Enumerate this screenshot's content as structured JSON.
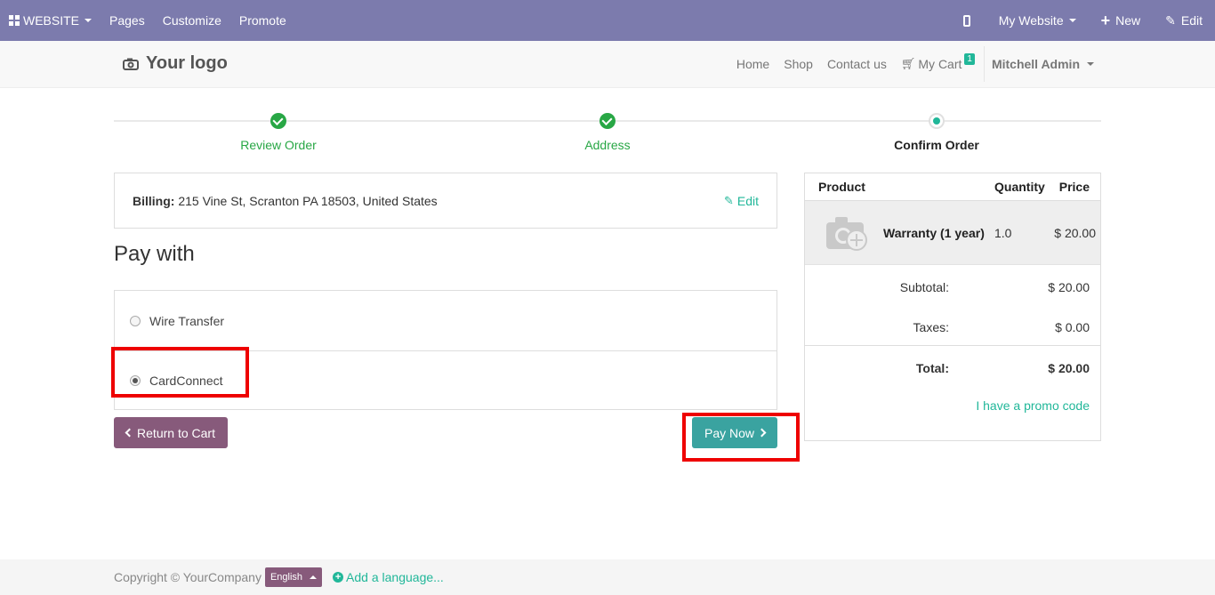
{
  "adminbar": {
    "website_label": "WEBSITE",
    "menu": [
      "Pages",
      "Customize",
      "Promote"
    ],
    "my_website_label": "My Website",
    "new_label": "New",
    "edit_label": "Edit",
    "color": "#7c7bad"
  },
  "header": {
    "logo_text": "Your logo",
    "nav": [
      "Home",
      "Shop",
      "Contact us"
    ],
    "cart_label": "My Cart",
    "cart_count": "1",
    "user_name": "Mitchell Admin"
  },
  "wizard": {
    "steps": [
      {
        "label": "Review Order",
        "state": "done"
      },
      {
        "label": "Address",
        "state": "done"
      },
      {
        "label": "Confirm Order",
        "state": "current"
      }
    ]
  },
  "billing": {
    "label": "Billing:",
    "address": "215 Vine St, Scranton PA 18503, United States",
    "edit_label": "Edit"
  },
  "payment": {
    "title": "Pay with",
    "options": [
      {
        "label": "Wire Transfer",
        "checked": false
      },
      {
        "label": "CardConnect",
        "checked": true
      }
    ],
    "return_label": "Return to Cart",
    "pay_label": "Pay Now"
  },
  "summary": {
    "headers": {
      "product": "Product",
      "quantity": "Quantity",
      "price": "Price"
    },
    "items": [
      {
        "name": "Warranty (1 year)",
        "quantity": "1.0",
        "price": "$ 20.00"
      }
    ],
    "subtotal_label": "Subtotal:",
    "subtotal_value": "$ 20.00",
    "taxes_label": "Taxes:",
    "taxes_value": "$ 0.00",
    "total_label": "Total:",
    "total_value": "$ 20.00",
    "promo_label": "I have a promo code"
  },
  "footer": {
    "copyright": "Copyright © YourCompany",
    "language": "English",
    "add_language": "Add a language..."
  },
  "colors": {
    "primary": "#875a7b",
    "accent": "#21b799",
    "success": "#28a745",
    "highlight": "#ee0000"
  }
}
